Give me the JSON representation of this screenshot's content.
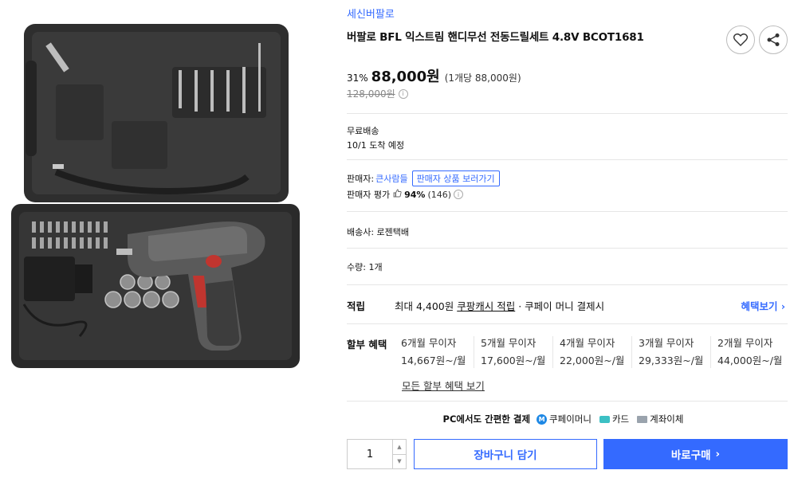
{
  "product": {
    "brand": "세신버팔로",
    "title": "버팔로 BFL 익스트림 핸디무선 전동드릴세트 4.8V BCOT1681",
    "image_icon": "drill-kit-image"
  },
  "actions": {
    "favorite_icon": "heart-icon",
    "share_icon": "share-icon"
  },
  "price": {
    "discount": "31%",
    "sale": "88,000원",
    "unit": "(1개당 88,000원)",
    "original": "128,000원",
    "info_glyph": "i"
  },
  "shipping": {
    "label": "무료배송",
    "arrival": "10/1 도착 예정"
  },
  "seller": {
    "label": "판매자:",
    "name": "큰사람들",
    "link": "판매자 상품 보러가기",
    "rating_label": "판매자 평가",
    "rating_pct": "94%",
    "rating_count": "(146)"
  },
  "carrier": {
    "text": "배송사:  로젠택배"
  },
  "quantity_info": {
    "text": "수량:  1개"
  },
  "reward": {
    "label": "적립",
    "prefix": "최대 4,400원 ",
    "link": "쿠팡캐시 적립",
    "suffix": " · 쿠페이 머니 결제시",
    "benefit": "혜택보기 ›"
  },
  "installment": {
    "label": "할부 혜택",
    "options": [
      {
        "name": "6개월 무이자",
        "price": "14,667원~/월"
      },
      {
        "name": "5개월 무이자",
        "price": "17,600원~/월"
      },
      {
        "name": "4개월 무이자",
        "price": "22,000원~/월"
      },
      {
        "name": "3개월 무이자",
        "price": "29,333원~/월"
      },
      {
        "name": "2개월 무이자",
        "price": "44,000원~/월"
      }
    ],
    "all_link": "모든 할부 혜택 보기"
  },
  "payment": {
    "title": "PC에서도 간편한 결제",
    "coupay_glyph": "M",
    "coupay": "쿠페이머니",
    "card": "카드",
    "bank": "계좌이체"
  },
  "order": {
    "quantity": "1",
    "stepper_up": "▲",
    "stepper_down": "▼",
    "cart": "장바구니 담기",
    "buy": "바로구매",
    "buy_chevron": "›"
  },
  "colors": {
    "accent": "#346aff",
    "case": "#2b2b2b",
    "drill_red": "#c0352f"
  }
}
